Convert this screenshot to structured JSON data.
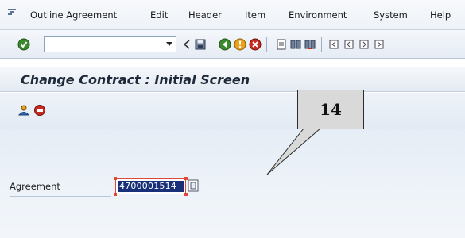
{
  "menu": {
    "items": [
      "Outline Agreement",
      "Edit",
      "Header",
      "Item",
      "Environment",
      "System",
      "Help"
    ]
  },
  "toolbar": {
    "command_value": "",
    "icons": [
      "enter-icon",
      "back-icon",
      "save-icon",
      "nav-back-icon",
      "exit-icon",
      "cancel-icon",
      "print-icon",
      "find-icon",
      "find-next-icon",
      "first-page-icon",
      "prev-page-icon",
      "next-page-icon",
      "last-page-icon"
    ]
  },
  "screen": {
    "title": "Change Contract : Initial Screen"
  },
  "form": {
    "agreement_label": "Agreement",
    "agreement_value": "4700001514"
  },
  "callout": {
    "text": "14"
  },
  "colors": {
    "selection": "#18307a",
    "required_marker": "#e0483a",
    "enter_green": "#3c8a2e"
  }
}
